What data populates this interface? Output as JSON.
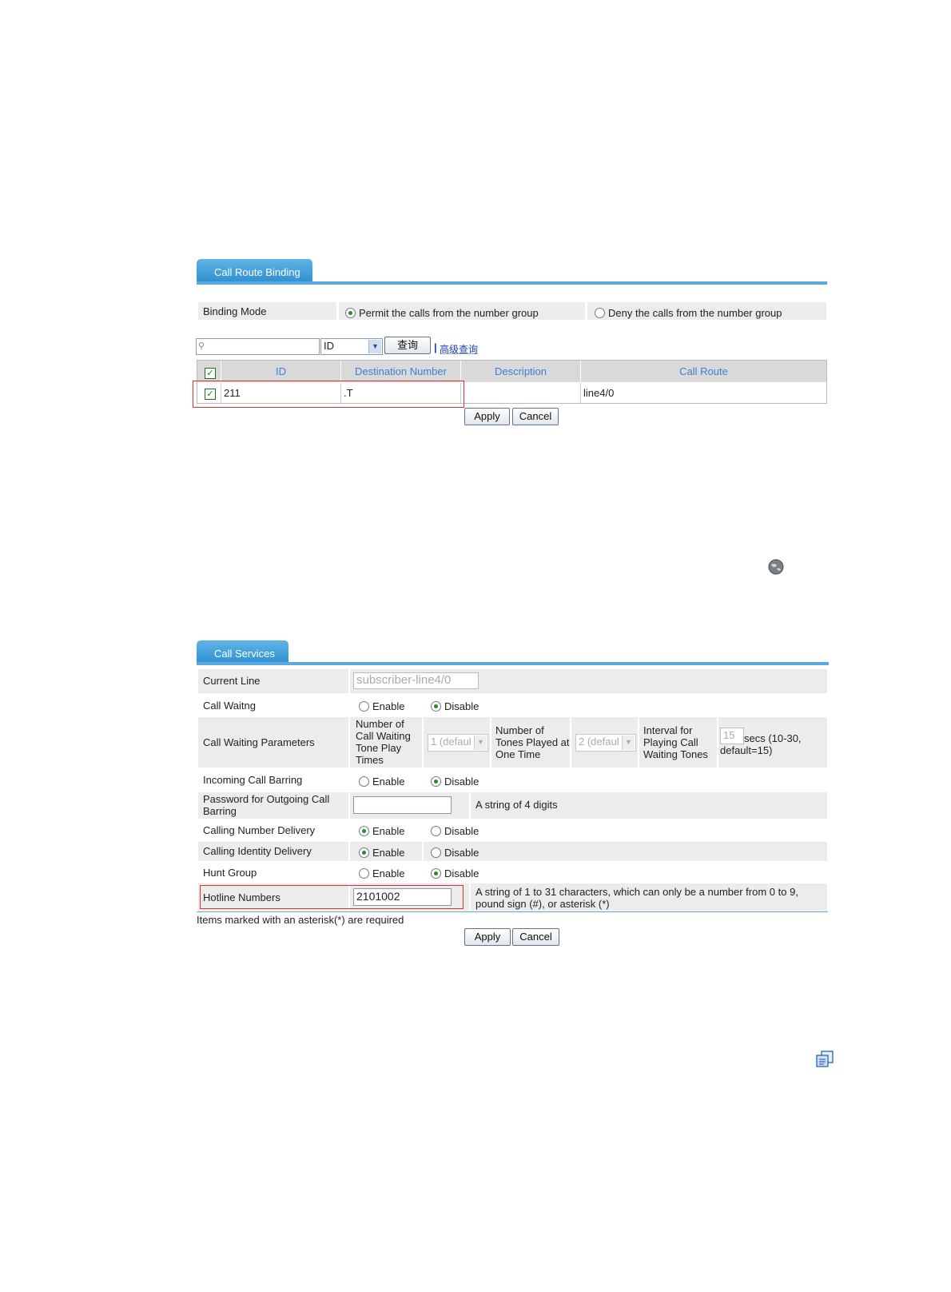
{
  "call_route_binding": {
    "tab_title": "Call Route Binding",
    "binding_mode_label": "Binding Mode",
    "permit_label": "Permit the calls from the number group",
    "deny_label": "Deny the calls from the number group",
    "search": {
      "value": "",
      "field_select": "ID",
      "query_button": "查询",
      "separator": "|",
      "advanced_link": "高级查询"
    },
    "table": {
      "headers": [
        "ID",
        "Destination Number",
        "Description",
        "Call Route"
      ],
      "rows": [
        {
          "id": "211",
          "destination": ".T",
          "description": "",
          "route": "line4/0"
        }
      ]
    },
    "apply_label": "Apply",
    "cancel_label": "Cancel"
  },
  "call_services": {
    "tab_title": "Call Services",
    "current_line_label": "Current Line",
    "current_line_value": "subscriber-line4/0",
    "call_waiting_label": "Call Waitng",
    "call_waiting_params_label": "Call Waiting Parameters",
    "tone_play_times_label": "Number of Call Waiting Tone Play Times",
    "tone_play_times_value": "1 (defaul",
    "tones_per_time_label": "Number of Tones Played at One Time",
    "tones_per_time_value": "2 (defaul",
    "interval_label": "Interval for Playing Call Waiting Tones",
    "interval_value": "15",
    "interval_hint": "secs (10-30, default=15)",
    "incoming_barring_label": "Incoming Call Barring",
    "outgoing_password_label": "Password for Outgoing Call Barring",
    "outgoing_password_value": "",
    "outgoing_password_hint": "A string of 4 digits",
    "calling_number_delivery_label": "Calling Number Delivery",
    "calling_identity_delivery_label": "Calling Identity Delivery",
    "hunt_group_label": "Hunt Group",
    "hotline_label": "Hotline Numbers",
    "hotline_value": "2101002",
    "hotline_hint": "A string of 1 to 31 characters, which can only be a number from 0 to 9, pound sign (#), or asterisk (*)",
    "enable_label": "Enable",
    "disable_label": "Disable",
    "required_note": "Items marked with an asterisk(*) are required",
    "apply_label": "Apply",
    "cancel_label": "Cancel"
  },
  "icons": [
    "search-icon",
    "chevron-down-icon",
    "checkmark-icon",
    "globe-icon",
    "copy-icon"
  ],
  "colors": {
    "tab": "#3a97d8",
    "header_text": "#3b7fd1",
    "highlight": "#e03030",
    "radio_dot": "#2a8a2a"
  }
}
